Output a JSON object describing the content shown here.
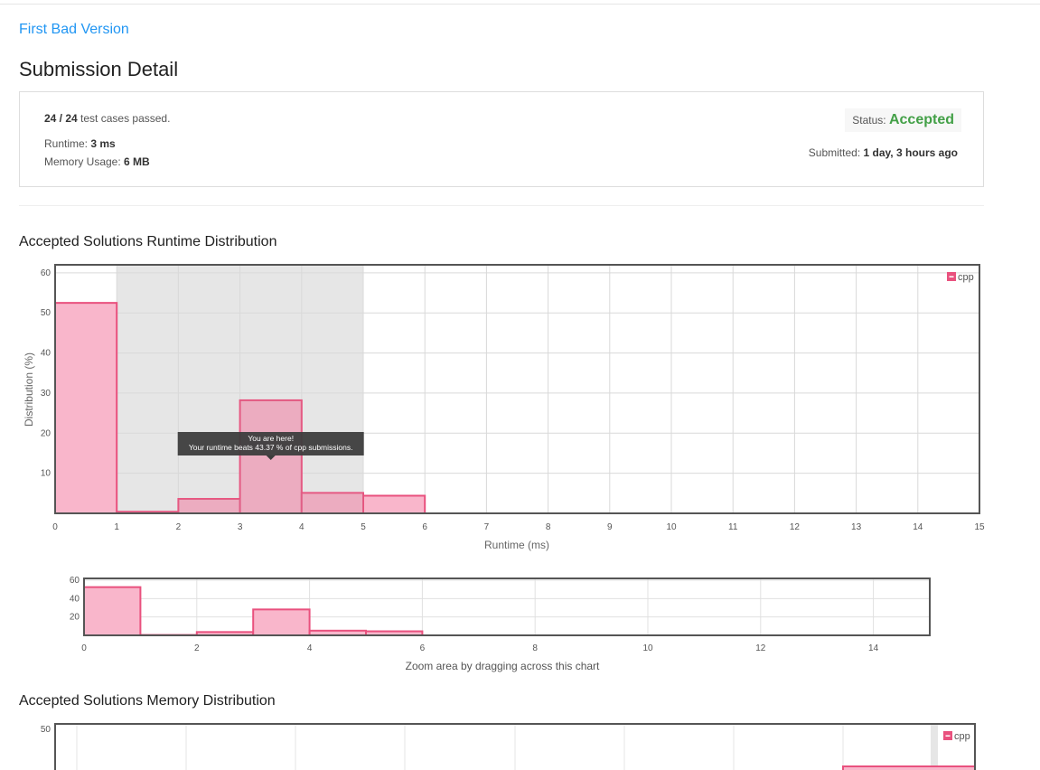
{
  "problem": {
    "title": "First Bad Version"
  },
  "page_title": "Submission Detail",
  "summary": {
    "passed": "24 / 24",
    "passed_suffix": "test cases passed.",
    "runtime_label": "Runtime:",
    "runtime_value": "3 ms",
    "memory_label": "Memory Usage:",
    "memory_value": "6 MB",
    "status_label": "Status:",
    "status_value": "Accepted",
    "submitted_label": "Submitted:",
    "submitted_value": "1 day, 3 hours ago"
  },
  "colors": {
    "accent_link": "#2196f3",
    "accepted": "#43a047",
    "bar_fill": "#f9b6cb",
    "bar_stroke": "#e9517e",
    "highlight_band": "#e6e6e6"
  },
  "runtime_chart_title": "Accepted Solutions Runtime Distribution",
  "navigator_caption": "Zoom area by dragging across this chart",
  "memory_chart_title": "Accepted Solutions Memory Distribution",
  "chart_data": [
    {
      "type": "bar",
      "title": "Accepted Solutions Runtime Distribution",
      "xlabel": "Runtime (ms)",
      "ylabel": "Distribution (%)",
      "x_ticks": [
        0,
        1,
        2,
        3,
        4,
        5,
        6,
        7,
        8,
        9,
        10,
        11,
        12,
        13,
        14,
        15
      ],
      "y_ticks": [
        10,
        20,
        30,
        40,
        50,
        60
      ],
      "xlim": [
        0,
        15
      ],
      "ylim": [
        0,
        62
      ],
      "grid": true,
      "legend": {
        "placement": "top-right",
        "entries": [
          "cpp"
        ]
      },
      "highlight_range": [
        1,
        5
      ],
      "series": [
        {
          "name": "cpp",
          "bins": [
            {
              "x0": 0,
              "x1": 1,
              "value": 52.5
            },
            {
              "x0": 1,
              "x1": 2,
              "value": 0.4
            },
            {
              "x0": 2,
              "x1": 3,
              "value": 3.6
            },
            {
              "x0": 3,
              "x1": 4,
              "value": 28.2
            },
            {
              "x0": 4,
              "x1": 5,
              "value": 5.1
            },
            {
              "x0": 5,
              "x1": 6,
              "value": 4.4
            }
          ]
        }
      ],
      "tooltip": {
        "line1": "You are here!",
        "line2": "Your runtime beats 43.37 % of cpp submissions.",
        "x": 3.5
      }
    },
    {
      "type": "bar",
      "title": "",
      "xlabel": "Zoom area by dragging across this chart",
      "x_ticks": [
        0,
        2,
        4,
        6,
        8,
        10,
        12,
        14
      ],
      "y_ticks": [
        20,
        40,
        60
      ],
      "xlim": [
        0,
        15
      ],
      "ylim": [
        0,
        62
      ],
      "grid": true,
      "series": [
        {
          "name": "cpp",
          "bins": [
            {
              "x0": 0,
              "x1": 1,
              "value": 52.5
            },
            {
              "x0": 1,
              "x1": 2,
              "value": 0.4
            },
            {
              "x0": 2,
              "x1": 3,
              "value": 3.6
            },
            {
              "x0": 3,
              "x1": 4,
              "value": 28.2
            },
            {
              "x0": 4,
              "x1": 5,
              "value": 5.1
            },
            {
              "x0": 5,
              "x1": 6,
              "value": 4.4
            }
          ]
        }
      ]
    },
    {
      "type": "bar",
      "title": "Accepted Solutions Memory Distribution",
      "y_ticks": [
        50
      ],
      "ylim": [
        0,
        52
      ],
      "grid": true,
      "legend": {
        "placement": "top-right",
        "entries": [
          "cpp"
        ]
      }
    }
  ]
}
